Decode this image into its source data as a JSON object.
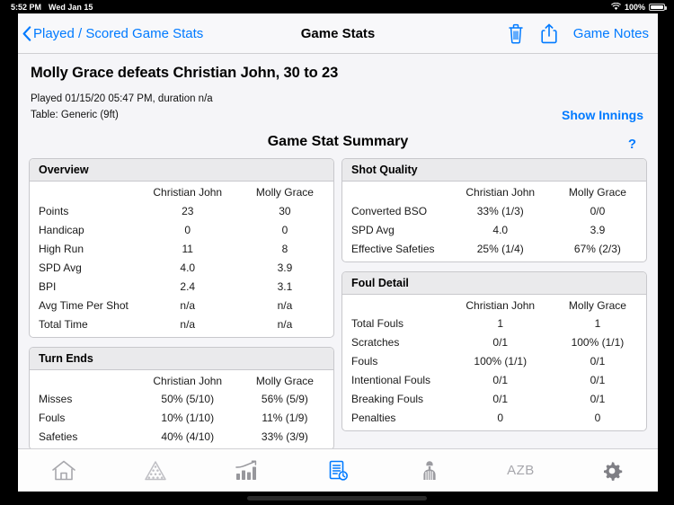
{
  "status_bar": {
    "time": "5:52 PM",
    "date": "Wed Jan 15",
    "battery_percent": "100%",
    "wifi_icon": "wifi-icon",
    "battery_icon": "battery-icon"
  },
  "navbar": {
    "back_label": "Played / Scored Game Stats",
    "back_chevron_icon": "chevron-left-icon",
    "title": "Game Stats",
    "delete_icon": "trash-icon",
    "share_icon": "share-icon",
    "notes_label": "Game Notes",
    "accent_color": "#007aff"
  },
  "header": {
    "match_title": "Molly Grace defeats Christian John, 30 to 23",
    "played_line": "Played 01/15/20 05:47 PM, duration n/a",
    "table_line": "Table: Generic (9ft)",
    "show_innings_label": "Show Innings",
    "summary_title": "Game Stat Summary",
    "help_label": "?"
  },
  "players": {
    "p1": "Christian John",
    "p2": "Molly Grace"
  },
  "panels": {
    "overview": {
      "title": "Overview",
      "columns": [
        "",
        "Christian John",
        "Molly Grace"
      ],
      "rows": [
        {
          "label": "Points",
          "p1": "23",
          "p2": "30"
        },
        {
          "label": "Handicap",
          "p1": "0",
          "p2": "0"
        },
        {
          "label": "High Run",
          "p1": "11",
          "p2": "8"
        },
        {
          "label": "SPD Avg",
          "p1": "4.0",
          "p2": "3.9"
        },
        {
          "label": "BPI",
          "p1": "2.4",
          "p2": "3.1"
        },
        {
          "label": "Avg Time Per Shot",
          "p1": "n/a",
          "p2": "n/a"
        },
        {
          "label": "Total Time",
          "p1": "n/a",
          "p2": "n/a"
        }
      ]
    },
    "turn_ends": {
      "title": "Turn Ends",
      "columns": [
        "",
        "Christian John",
        "Molly Grace"
      ],
      "rows": [
        {
          "label": "Misses",
          "p1": "50% (5/10)",
          "p2": "56% (5/9)"
        },
        {
          "label": "Fouls",
          "p1": "10% (1/10)",
          "p2": "11% (1/9)"
        },
        {
          "label": "Safeties",
          "p1": "40% (4/10)",
          "p2": "33% (3/9)"
        }
      ]
    },
    "shot_quality": {
      "title": "Shot Quality",
      "columns": [
        "",
        "Christian John",
        "Molly Grace"
      ],
      "rows": [
        {
          "label": "Converted BSO",
          "p1": "33% (1/3)",
          "p2": "0/0"
        },
        {
          "label": "SPD Avg",
          "p1": "4.0",
          "p2": "3.9"
        },
        {
          "label": "Effective Safeties",
          "p1": "25% (1/4)",
          "p2": "67% (2/3)"
        }
      ]
    },
    "foul_detail": {
      "title": "Foul Detail",
      "columns": [
        "",
        "Christian John",
        "Molly Grace"
      ],
      "rows": [
        {
          "label": "Total Fouls",
          "p1": "1",
          "p2": "1"
        },
        {
          "label": "Scratches",
          "p1": "0/1",
          "p2": "100% (1/1)"
        },
        {
          "label": "Fouls",
          "p1": "100% (1/1)",
          "p2": "0/1"
        },
        {
          "label": "Intentional Fouls",
          "p1": "0/1",
          "p2": "0/1"
        },
        {
          "label": "Breaking Fouls",
          "p1": "0/1",
          "p2": "0/1"
        },
        {
          "label": "Penalties",
          "p1": "0",
          "p2": "0"
        }
      ]
    }
  },
  "tabbar": {
    "items": [
      {
        "icon": "home-icon",
        "label": "",
        "selected": false
      },
      {
        "icon": "ball-rack-icon",
        "label": "",
        "selected": false
      },
      {
        "icon": "bar-chart-icon",
        "label": "",
        "selected": false
      },
      {
        "icon": "document-clock-icon",
        "label": "",
        "selected": true
      },
      {
        "icon": "referee-icon",
        "label": "",
        "selected": false
      },
      {
        "icon": "azb-text-icon",
        "label": "AZB",
        "selected": false
      },
      {
        "icon": "gear-icon",
        "label": "",
        "selected": false
      }
    ],
    "selected_color": "#007aff",
    "inactive_color": "#a7a7ac"
  }
}
